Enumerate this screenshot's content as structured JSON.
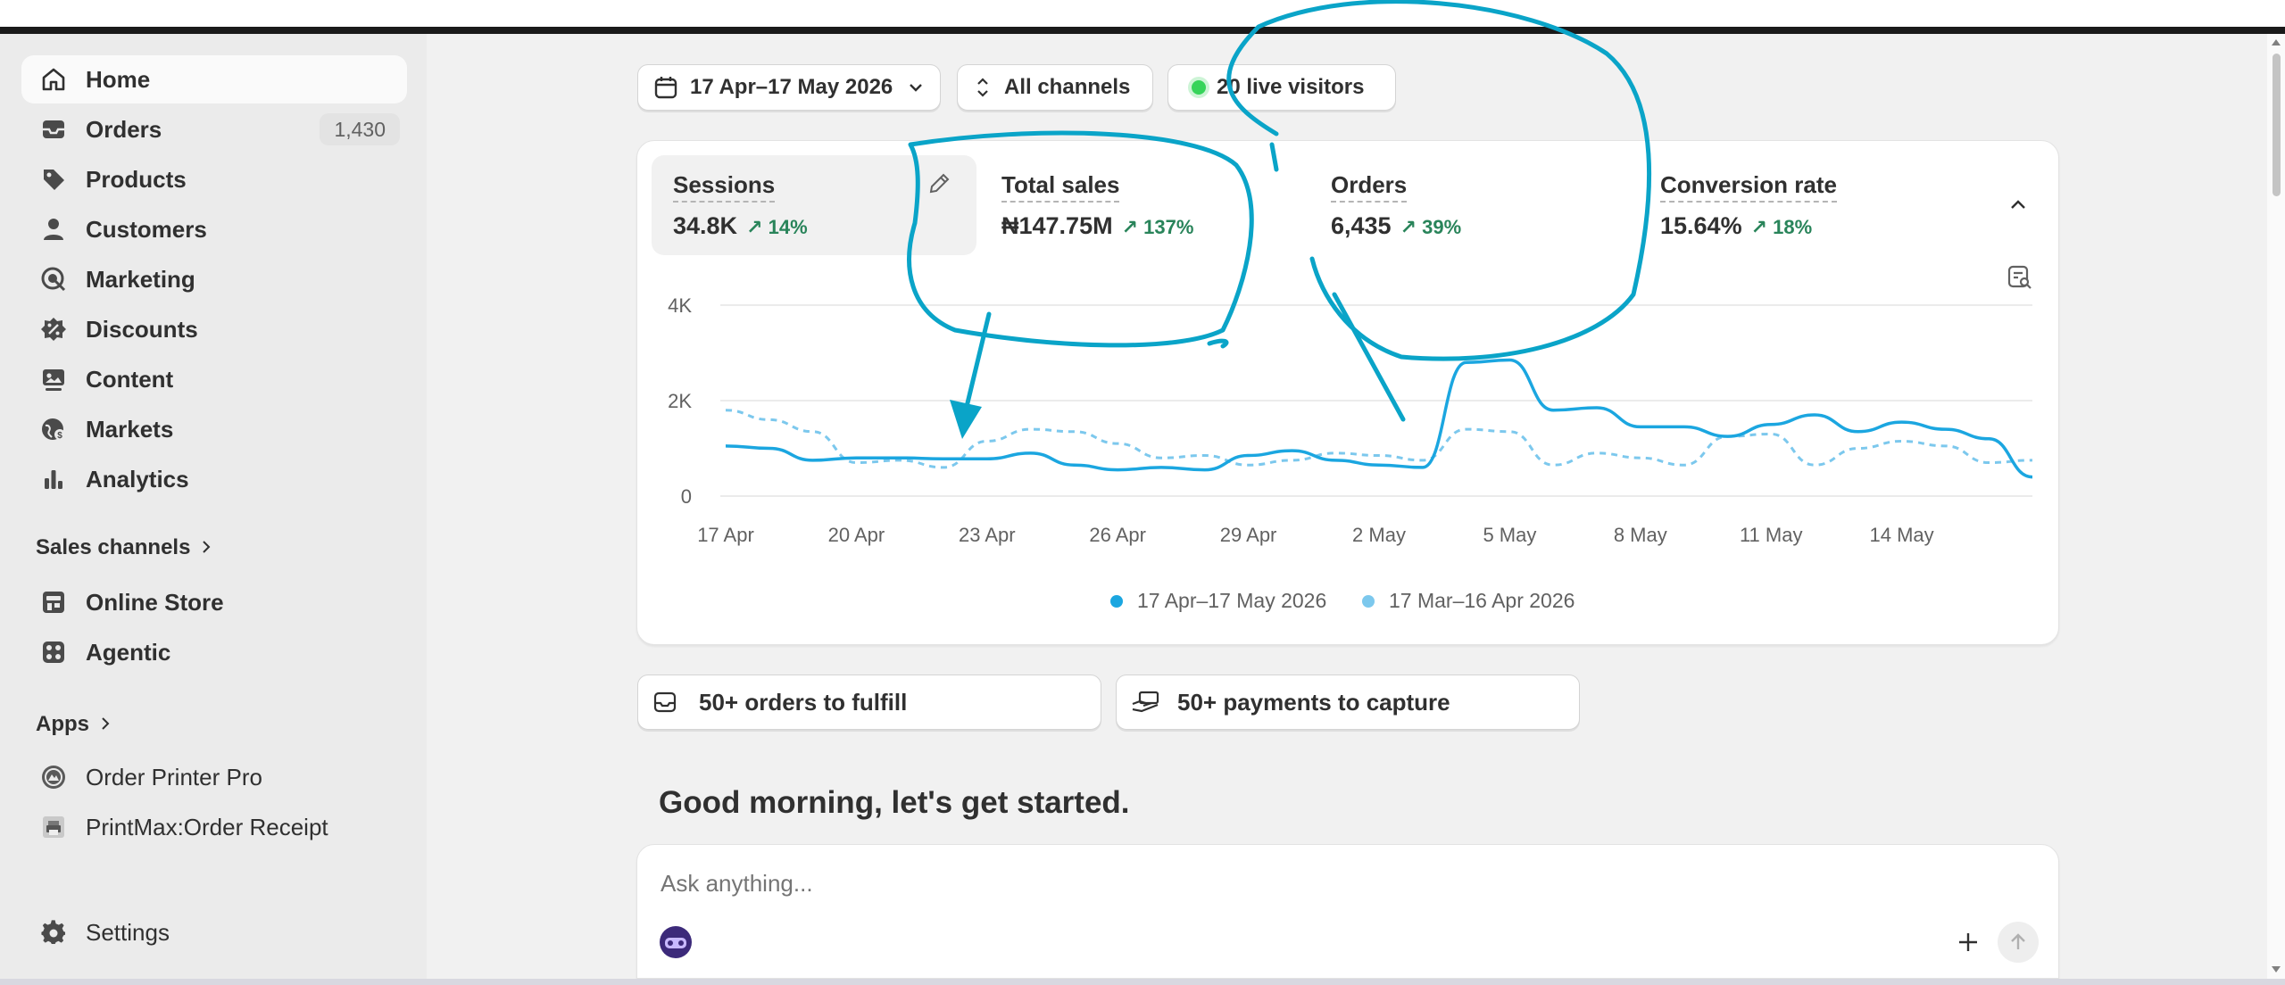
{
  "sidebar": {
    "items": [
      {
        "label": "Home",
        "icon": "home-icon"
      },
      {
        "label": "Orders",
        "icon": "inbox-icon",
        "badge": "1,430"
      },
      {
        "label": "Products",
        "icon": "tag-icon"
      },
      {
        "label": "Customers",
        "icon": "person-icon"
      },
      {
        "label": "Marketing",
        "icon": "target-icon"
      },
      {
        "label": "Discounts",
        "icon": "discount-icon"
      },
      {
        "label": "Content",
        "icon": "content-icon"
      },
      {
        "label": "Markets",
        "icon": "globe-icon"
      },
      {
        "label": "Analytics",
        "icon": "bar-chart-icon"
      }
    ],
    "sales_channels": {
      "title": "Sales channels",
      "items": [
        {
          "label": "Online Store",
          "icon": "store-icon"
        },
        {
          "label": "Agentic",
          "icon": "agentic-icon"
        }
      ]
    },
    "apps": {
      "title": "Apps",
      "items": [
        {
          "label": "Order Printer Pro",
          "icon": "order-printer-app-icon"
        },
        {
          "label": "PrintMax:Order Receipt",
          "icon": "printmax-app-icon"
        }
      ]
    },
    "settings_label": "Settings"
  },
  "filters": {
    "date_range": "17 Apr–17 May 2026",
    "channels": "All channels",
    "live_visitors": "20 live visitors"
  },
  "metrics": [
    {
      "label": "Sessions",
      "value": "34.8K",
      "change": "14%"
    },
    {
      "label": "Total sales",
      "value": "₦147.75M",
      "change": "137%"
    },
    {
      "label": "Orders",
      "value": "6,435",
      "change": "39%"
    },
    {
      "label": "Conversion rate",
      "value": "15.64%",
      "change": "18%"
    }
  ],
  "chart_data": {
    "type": "line",
    "y_ticks": [
      "4K",
      "2K",
      "0"
    ],
    "ylim": [
      0,
      4000
    ],
    "x_tick_labels": [
      "17 Apr",
      "20 Apr",
      "23 Apr",
      "26 Apr",
      "29 Apr",
      "2 May",
      "5 May",
      "8 May",
      "11 May",
      "14 May"
    ],
    "x": [
      "17 Apr",
      "18 Apr",
      "19 Apr",
      "20 Apr",
      "21 Apr",
      "22 Apr",
      "23 Apr",
      "24 Apr",
      "25 Apr",
      "26 Apr",
      "27 Apr",
      "28 Apr",
      "29 Apr",
      "30 Apr",
      "1 May",
      "2 May",
      "3 May",
      "4 May",
      "5 May",
      "6 May",
      "7 May",
      "8 May",
      "9 May",
      "10 May",
      "11 May",
      "12 May",
      "13 May",
      "14 May",
      "15 May",
      "16 May",
      "17 May"
    ],
    "series": [
      {
        "name": "17 Apr–17 May 2026",
        "color": "#1ba6e0",
        "dashed": false,
        "values": [
          1050,
          1000,
          750,
          800,
          800,
          780,
          780,
          900,
          650,
          550,
          600,
          550,
          850,
          950,
          750,
          650,
          600,
          2800,
          2850,
          1800,
          1850,
          1450,
          1450,
          1250,
          1500,
          1700,
          1350,
          1550,
          1400,
          1200,
          400
        ]
      },
      {
        "name": "17 Mar–16 Apr 2026",
        "color": "#7cc8ed",
        "dashed": true,
        "values": [
          1800,
          1600,
          1350,
          700,
          750,
          600,
          1150,
          1400,
          1350,
          1100,
          800,
          850,
          650,
          750,
          900,
          850,
          750,
          1400,
          1350,
          650,
          900,
          800,
          650,
          1250,
          1300,
          650,
          1000,
          1150,
          1050,
          700,
          750
        ]
      }
    ],
    "grid": true
  },
  "legend": {
    "current": "17 Apr–17 May 2026",
    "previous": "17 Mar–16 Apr 2026"
  },
  "tasks": {
    "fulfill": "50+ orders to fulfill",
    "payments": "50+ payments to capture"
  },
  "greeting": "Good morning, let's get started.",
  "ask": {
    "placeholder": "Ask anything..."
  },
  "colors": {
    "annotation": "#0aa4c8",
    "positive_change": "#29845a",
    "live_dot": "#36d45a"
  }
}
